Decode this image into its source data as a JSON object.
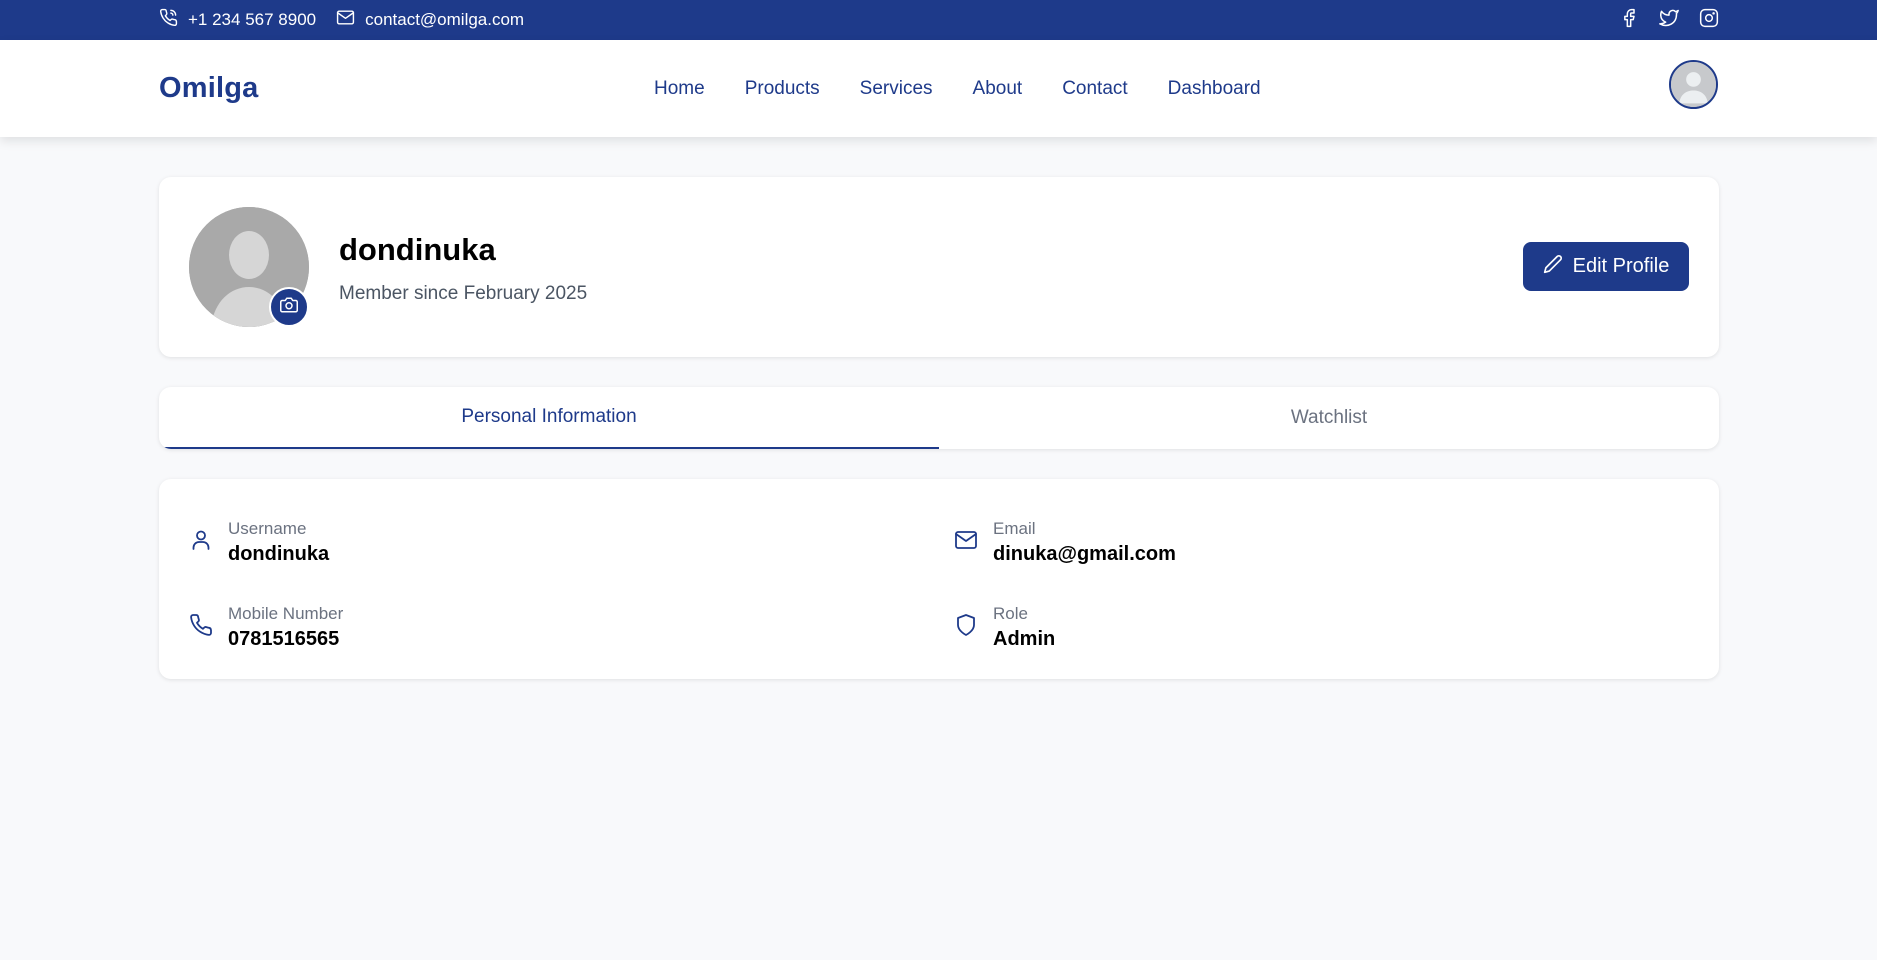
{
  "topbar": {
    "phone": "+1 234 567 8900",
    "email": "contact@omilga.com",
    "social_icons": [
      "facebook-icon",
      "twitter-icon",
      "instagram-icon"
    ]
  },
  "navbar": {
    "logo": "Omilga",
    "links": [
      "Home",
      "Products",
      "Services",
      "About",
      "Contact",
      "Dashboard"
    ]
  },
  "profile": {
    "name": "dondinuka",
    "member_since": "Member since February 2025",
    "edit_label": "Edit Profile"
  },
  "tabs": [
    {
      "label": "Personal Information",
      "active": true
    },
    {
      "label": "Watchlist",
      "active": false
    }
  ],
  "info": {
    "username": {
      "label": "Username",
      "value": "dondinuka",
      "icon": "user-icon"
    },
    "email": {
      "label": "Email",
      "value": "dinuka@gmail.com",
      "icon": "mail-icon"
    },
    "mobile": {
      "label": "Mobile Number",
      "value": "0781516565",
      "icon": "phone-icon"
    },
    "role": {
      "label": "Role",
      "value": "Admin",
      "icon": "shield-icon"
    }
  },
  "colors": {
    "primary": "#1e3a8a",
    "background": "#f8f9fb",
    "muted_text": "#6b7280"
  }
}
